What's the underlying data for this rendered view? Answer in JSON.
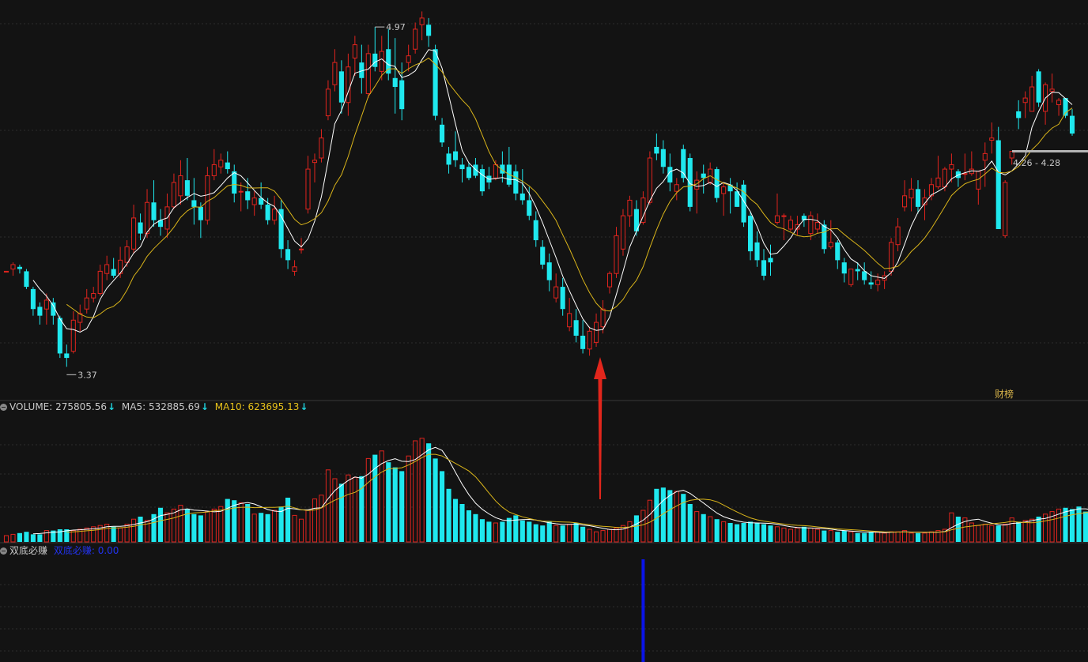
{
  "colors": {
    "background": "#131313",
    "up": "#e0241e",
    "down": "#1fe8ee",
    "ma_fast": "#ffffff",
    "ma_slow": "#d9b41a",
    "grid": "#2c2c2c",
    "text": "#c9c9c9",
    "ma10_text": "#e8c21a",
    "signal": "#0a14e8",
    "arrow": "#e2261c"
  },
  "price_panel": {
    "high_label": "4.97",
    "low_label": "3.37",
    "range_label": "4.26 - 4.28",
    "badge": "财榜"
  },
  "volume_panel": {
    "label": "VOLUME:",
    "volume_value": "275805.56",
    "ma5_label": "MA5:",
    "ma5_value": "532885.69",
    "ma10_label": "MA10:",
    "ma10_value": "623695.13",
    "arrow_icon": "down-arrow"
  },
  "indicator_panel": {
    "name": "双底必赚",
    "sub_label": "双底必赚:",
    "sub_value": "0.00"
  },
  "chart_data": [
    {
      "type": "candlestick",
      "title": "",
      "ylim": [
        3.3,
        5.0
      ],
      "annotations": [
        {
          "text": "4.97",
          "at_bar": 55
        },
        {
          "text": "3.37",
          "at_bar": 9
        },
        {
          "text": "4.26 - 4.28",
          "kind": "price range"
        }
      ],
      "ohlc": [
        [
          3.8,
          3.8,
          3.8,
          3.8
        ],
        [
          3.81,
          3.84,
          3.78,
          3.83
        ],
        [
          3.82,
          3.83,
          3.79,
          3.81
        ],
        [
          3.8,
          3.81,
          3.72,
          3.73
        ],
        [
          3.72,
          3.73,
          3.6,
          3.63
        ],
        [
          3.64,
          3.66,
          3.56,
          3.6
        ],
        [
          3.63,
          3.7,
          3.56,
          3.67
        ],
        [
          3.66,
          3.68,
          3.56,
          3.6
        ],
        [
          3.59,
          3.6,
          3.41,
          3.43
        ],
        [
          3.43,
          3.47,
          3.37,
          3.41
        ],
        [
          3.44,
          3.62,
          3.43,
          3.58
        ],
        [
          3.57,
          3.65,
          3.53,
          3.61
        ],
        [
          3.63,
          3.72,
          3.61,
          3.68
        ],
        [
          3.68,
          3.73,
          3.66,
          3.7
        ],
        [
          3.7,
          3.83,
          3.69,
          3.8
        ],
        [
          3.79,
          3.87,
          3.76,
          3.83
        ],
        [
          3.81,
          3.86,
          3.77,
          3.78
        ],
        [
          3.79,
          3.91,
          3.77,
          3.85
        ],
        [
          3.84,
          3.94,
          3.82,
          3.91
        ],
        [
          3.9,
          4.1,
          3.88,
          4.04
        ],
        [
          4.02,
          4.06,
          3.94,
          3.97
        ],
        [
          3.97,
          4.17,
          3.95,
          4.11
        ],
        [
          4.11,
          4.21,
          4.0,
          4.03
        ],
        [
          4.03,
          4.08,
          3.96,
          4.0
        ],
        [
          3.99,
          4.15,
          3.95,
          4.09
        ],
        [
          4.09,
          4.24,
          4.08,
          4.2
        ],
        [
          4.14,
          4.3,
          4.1,
          4.23
        ],
        [
          4.21,
          4.31,
          4.12,
          4.14
        ],
        [
          4.12,
          4.22,
          4.01,
          4.09
        ],
        [
          4.09,
          4.11,
          3.95,
          4.03
        ],
        [
          4.03,
          4.27,
          4.01,
          4.23
        ],
        [
          4.23,
          4.35,
          4.21,
          4.28
        ],
        [
          4.27,
          4.33,
          4.24,
          4.3
        ],
        [
          4.29,
          4.34,
          4.24,
          4.26
        ],
        [
          4.25,
          4.28,
          4.11,
          4.15
        ],
        [
          4.16,
          4.2,
          4.07,
          4.16
        ],
        [
          4.16,
          4.22,
          4.08,
          4.12
        ],
        [
          4.1,
          4.16,
          4.05,
          4.13
        ],
        [
          4.13,
          4.2,
          4.08,
          4.1
        ],
        [
          4.1,
          4.13,
          4.01,
          4.03
        ],
        [
          4.03,
          4.14,
          4.01,
          4.08
        ],
        [
          4.08,
          4.12,
          3.86,
          3.9
        ],
        [
          3.9,
          3.94,
          3.81,
          3.85
        ],
        [
          3.8,
          3.85,
          3.78,
          3.82
        ],
        [
          3.9,
          3.95,
          3.88,
          3.9
        ],
        [
          4.08,
          4.32,
          4.06,
          4.26
        ],
        [
          4.29,
          4.33,
          4.2,
          4.3
        ],
        [
          4.31,
          4.44,
          4.29,
          4.4
        ],
        [
          4.5,
          4.66,
          4.48,
          4.62
        ],
        [
          4.64,
          4.8,
          4.61,
          4.74
        ],
        [
          4.7,
          4.75,
          4.51,
          4.56
        ],
        [
          4.56,
          4.78,
          4.5,
          4.72
        ],
        [
          4.76,
          4.86,
          4.68,
          4.82
        ],
        [
          4.74,
          4.82,
          4.6,
          4.67
        ],
        [
          4.6,
          4.82,
          4.58,
          4.78
        ],
        [
          4.78,
          4.9,
          4.7,
          4.72
        ],
        [
          4.7,
          4.86,
          4.66,
          4.79
        ],
        [
          4.8,
          4.89,
          4.66,
          4.69
        ],
        [
          4.67,
          4.85,
          4.51,
          4.63
        ],
        [
          4.66,
          4.74,
          4.48,
          4.53
        ],
        [
          4.74,
          4.82,
          4.7,
          4.77
        ],
        [
          4.8,
          4.92,
          4.78,
          4.89
        ],
        [
          4.91,
          4.97,
          4.84,
          4.94
        ],
        [
          4.91,
          4.94,
          4.81,
          4.86
        ],
        [
          4.8,
          4.82,
          4.48,
          4.5
        ],
        [
          4.46,
          4.49,
          4.36,
          4.38
        ],
        [
          4.33,
          4.36,
          4.24,
          4.28
        ],
        [
          4.34,
          4.43,
          4.27,
          4.3
        ],
        [
          4.28,
          4.31,
          4.2,
          4.26
        ],
        [
          4.27,
          4.29,
          4.21,
          4.22
        ],
        [
          4.28,
          4.31,
          4.22,
          4.23
        ],
        [
          4.26,
          4.28,
          4.14,
          4.16
        ],
        [
          4.23,
          4.27,
          4.17,
          4.2
        ],
        [
          4.22,
          4.3,
          4.21,
          4.28
        ],
        [
          4.28,
          4.34,
          4.2,
          4.24
        ],
        [
          4.28,
          4.36,
          4.18,
          4.19
        ],
        [
          4.25,
          4.28,
          4.12,
          4.15
        ],
        [
          4.15,
          4.26,
          4.1,
          4.12
        ],
        [
          4.12,
          4.18,
          4.03,
          4.05
        ],
        [
          4.03,
          4.07,
          3.91,
          3.94
        ],
        [
          3.91,
          3.94,
          3.81,
          3.83
        ],
        [
          3.84,
          3.88,
          3.71,
          3.76
        ],
        [
          3.68,
          3.79,
          3.66,
          3.73
        ],
        [
          3.73,
          3.77,
          3.6,
          3.63
        ],
        [
          3.55,
          3.68,
          3.53,
          3.61
        ],
        [
          3.58,
          3.63,
          3.48,
          3.51
        ],
        [
          3.51,
          3.58,
          3.43,
          3.45
        ],
        [
          3.45,
          3.55,
          3.42,
          3.53
        ],
        [
          3.48,
          3.61,
          3.46,
          3.57
        ],
        [
          3.55,
          3.67,
          3.52,
          3.63
        ],
        [
          3.73,
          3.8,
          3.7,
          3.79
        ],
        [
          3.79,
          4.0,
          3.77,
          3.96
        ],
        [
          3.9,
          4.08,
          3.87,
          4.05
        ],
        [
          4.05,
          4.14,
          4.0,
          4.12
        ],
        [
          4.08,
          4.12,
          3.96,
          3.98
        ],
        [
          4.02,
          4.16,
          4.01,
          4.13
        ],
        [
          4.11,
          4.34,
          4.1,
          4.31
        ],
        [
          4.36,
          4.42,
          4.3,
          4.33
        ],
        [
          4.35,
          4.39,
          4.24,
          4.27
        ],
        [
          4.27,
          4.33,
          4.16,
          4.2
        ],
        [
          4.16,
          4.22,
          4.12,
          4.19
        ],
        [
          4.35,
          4.37,
          4.2,
          4.22
        ],
        [
          4.31,
          4.33,
          4.07,
          4.09
        ],
        [
          4.17,
          4.25,
          4.06,
          4.21
        ],
        [
          4.24,
          4.28,
          4.15,
          4.22
        ],
        [
          4.2,
          4.29,
          4.19,
          4.26
        ],
        [
          4.26,
          4.27,
          4.11,
          4.13
        ],
        [
          4.15,
          4.2,
          4.05,
          4.18
        ],
        [
          4.19,
          4.22,
          4.06,
          4.16
        ],
        [
          4.16,
          4.2,
          4.09,
          4.09
        ],
        [
          4.19,
          4.21,
          4.0,
          4.02
        ],
        [
          4.05,
          4.07,
          3.85,
          3.89
        ],
        [
          3.93,
          3.98,
          3.82,
          3.85
        ],
        [
          3.85,
          3.9,
          3.76,
          3.78
        ],
        [
          3.86,
          3.92,
          3.78,
          3.84
        ],
        [
          4.02,
          4.15,
          4.01,
          4.05
        ],
        [
          4.05,
          4.06,
          3.94,
          4.05
        ],
        [
          3.99,
          4.05,
          3.98,
          4.03
        ],
        [
          3.99,
          4.05,
          3.96,
          4.01
        ],
        [
          4.05,
          4.06,
          4.0,
          4.03
        ],
        [
          3.97,
          4.07,
          3.94,
          4.05
        ],
        [
          3.99,
          4.06,
          3.97,
          4.02
        ],
        [
          4.01,
          4.03,
          3.88,
          3.9
        ],
        [
          3.91,
          4.03,
          3.9,
          3.93
        ],
        [
          3.93,
          3.94,
          3.81,
          3.85
        ],
        [
          3.84,
          3.86,
          3.75,
          3.79
        ],
        [
          3.74,
          3.8,
          3.73,
          3.81
        ],
        [
          3.81,
          3.84,
          3.76,
          3.8
        ],
        [
          3.8,
          3.84,
          3.74,
          3.76
        ],
        [
          3.75,
          3.8,
          3.72,
          3.74
        ],
        [
          3.74,
          3.79,
          3.71,
          3.76
        ],
        [
          3.76,
          3.8,
          3.72,
          3.78
        ],
        [
          3.8,
          3.95,
          3.78,
          3.93
        ],
        [
          3.92,
          4.04,
          3.89,
          4.0
        ],
        [
          4.09,
          4.21,
          4.07,
          4.14
        ],
        [
          4.13,
          4.22,
          4.07,
          4.17
        ],
        [
          4.17,
          4.21,
          4.06,
          4.09
        ],
        [
          4.1,
          4.17,
          4.03,
          4.13
        ],
        [
          4.14,
          4.22,
          4.12,
          4.19
        ],
        [
          4.18,
          4.32,
          4.17,
          4.22
        ],
        [
          4.18,
          4.27,
          4.16,
          4.26
        ],
        [
          4.26,
          4.33,
          4.2,
          4.28
        ],
        [
          4.25,
          4.26,
          4.18,
          4.22
        ],
        [
          4.24,
          4.33,
          4.21,
          4.24
        ],
        [
          4.24,
          4.34,
          4.23,
          4.26
        ],
        [
          4.17,
          4.23,
          4.1,
          4.25
        ],
        [
          4.3,
          4.38,
          4.18,
          4.33
        ],
        [
          4.39,
          4.47,
          4.33,
          4.4
        ],
        [
          4.39,
          4.45,
          4.19,
          3.99
        ],
        [
          3.96,
          4.21,
          3.95,
          4.2
        ],
        [
          4.31,
          4.34,
          4.28,
          4.34
        ],
        [
          4.52,
          4.57,
          4.44,
          4.49
        ],
        [
          4.56,
          4.61,
          4.49,
          4.58
        ],
        [
          4.52,
          4.68,
          4.52,
          4.63
        ],
        [
          4.7,
          4.71,
          4.54,
          4.56
        ],
        [
          4.52,
          4.65,
          4.46,
          4.64
        ],
        [
          4.61,
          4.69,
          4.56,
          4.62
        ],
        [
          4.55,
          4.58,
          4.5,
          4.57
        ],
        [
          4.58,
          4.58,
          4.49,
          4.5
        ],
        [
          4.5,
          4.53,
          4.41,
          4.42
        ]
      ]
    },
    {
      "type": "bar",
      "title": "VOLUME",
      "series_names": [
        "VOLUME",
        "MA5",
        "MA10"
      ],
      "values": [
        0.05,
        0.06,
        0.07,
        0.08,
        0.06,
        0.06,
        0.09,
        0.09,
        0.1,
        0.1,
        0.09,
        0.1,
        0.11,
        0.12,
        0.13,
        0.14,
        0.12,
        0.11,
        0.14,
        0.18,
        0.2,
        0.17,
        0.22,
        0.27,
        0.23,
        0.26,
        0.29,
        0.26,
        0.22,
        0.21,
        0.24,
        0.26,
        0.28,
        0.34,
        0.33,
        0.31,
        0.3,
        0.22,
        0.23,
        0.22,
        0.25,
        0.28,
        0.35,
        0.21,
        0.18,
        0.25,
        0.34,
        0.37,
        0.57,
        0.5,
        0.46,
        0.53,
        0.51,
        0.52,
        0.66,
        0.69,
        0.72,
        0.63,
        0.59,
        0.56,
        0.68,
        0.8,
        0.82,
        0.78,
        0.66,
        0.56,
        0.42,
        0.34,
        0.3,
        0.25,
        0.22,
        0.18,
        0.16,
        0.15,
        0.16,
        0.19,
        0.21,
        0.17,
        0.16,
        0.14,
        0.13,
        0.16,
        0.13,
        0.13,
        0.14,
        0.15,
        0.12,
        0.1,
        0.08,
        0.09,
        0.1,
        0.11,
        0.13,
        0.16,
        0.21,
        0.25,
        0.33,
        0.42,
        0.43,
        0.41,
        0.4,
        0.38,
        0.3,
        0.24,
        0.22,
        0.2,
        0.18,
        0.16,
        0.15,
        0.14,
        0.15,
        0.16,
        0.15,
        0.14,
        0.13,
        0.12,
        0.11,
        0.1,
        0.11,
        0.12,
        0.11,
        0.1,
        0.09,
        0.09,
        0.08,
        0.09,
        0.08,
        0.07,
        0.07,
        0.08,
        0.08,
        0.07,
        0.08,
        0.08,
        0.09,
        0.07,
        0.07,
        0.07,
        0.08,
        0.09,
        0.1,
        0.23,
        0.2,
        0.19,
        0.15,
        0.13,
        0.14,
        0.13,
        0.13,
        0.14,
        0.19,
        0.16,
        0.17,
        0.18,
        0.2,
        0.22,
        0.24,
        0.26,
        0.27,
        0.26,
        0.28,
        0.24,
        0.22,
        0.3,
        0.18,
        0.14
      ]
    },
    {
      "type": "bar",
      "title": "双底必赚",
      "x": [
        95
      ],
      "values": [
        1
      ]
    }
  ]
}
